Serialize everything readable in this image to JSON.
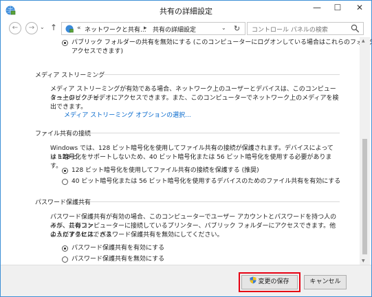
{
  "window": {
    "title": "共有の詳細設定"
  },
  "titlebar": {
    "minimize": "—",
    "maximize": "☐",
    "close": "✕"
  },
  "nav": {
    "back": "←",
    "forward": "→",
    "recent": "⌄",
    "up": "↑",
    "address": {
      "overflow": "«",
      "crumbs": [
        "ネットワークと共有...",
        "共有の詳細設定"
      ],
      "separator": "▸"
    },
    "dropdown": "⌄",
    "refresh": "↻",
    "search_placeholder": "コントロール パネルの検索"
  },
  "sections": {
    "public_folder": {
      "option_line1": "パブリック フォルダーの共有を無効にする (このコンピューターにログオンしている場合はこれらのフォルダーに",
      "option_line2": "アクセスできます)",
      "checked": true
    },
    "media": {
      "title": "メディア ストリーミング",
      "desc_line1": "メディア ストリーミングが有効である場合、ネットワーク上のユーザーとデバイスは、このコンピューター上のピクチャ、",
      "desc_line2": "ミュージック、ビデオにアクセスできます。また、このコンピューターでネットワーク上のメディアを検出できます。",
      "link": "メディア ストリーミング オプションの選択..."
    },
    "file_sharing": {
      "title": "ファイル共有の接続",
      "desc_line1": "Windows では、128 ビット暗号化を使用してファイル共有の接続が保護されます。デバイスによっては 128 ビ",
      "desc_line2": "ット暗号化をサポートしないため、40 ビット暗号化または 56 ビット暗号化を使用する必要があります。",
      "options": [
        {
          "label": "128 ビット暗号化を使用してファイル共有の接続を保護する (推奨)",
          "checked": true
        },
        {
          "label": "40 ビット暗号化または 56 ビット暗号化を使用するデバイスのためのファイル共有を有効にする",
          "checked": false
        }
      ]
    },
    "password": {
      "title": "パスワード保護共有",
      "desc_line1": "パスワード保護共有が有効の場合、このコンピューターでユーザー アカウントとパスワードを持つ人のみが、共有ファ",
      "desc_line2": "イル、このコンピューターに接続しているプリンター、パブリック フォルダーにアクセスできます。他の人がアクセスできる",
      "desc_line3": "ようにするには、パスワード保護共有を無効にしてください。",
      "options": [
        {
          "label": "パスワード保護共有を有効にする",
          "checked": true
        },
        {
          "label": "パスワード保護共有を無効にする",
          "checked": false
        }
      ]
    }
  },
  "footer": {
    "save_label": "変更の保存",
    "cancel_label": "キャンセル"
  },
  "colors": {
    "highlight": "#e60012",
    "link": "#0066cc",
    "frame": "#3c8fd6"
  }
}
